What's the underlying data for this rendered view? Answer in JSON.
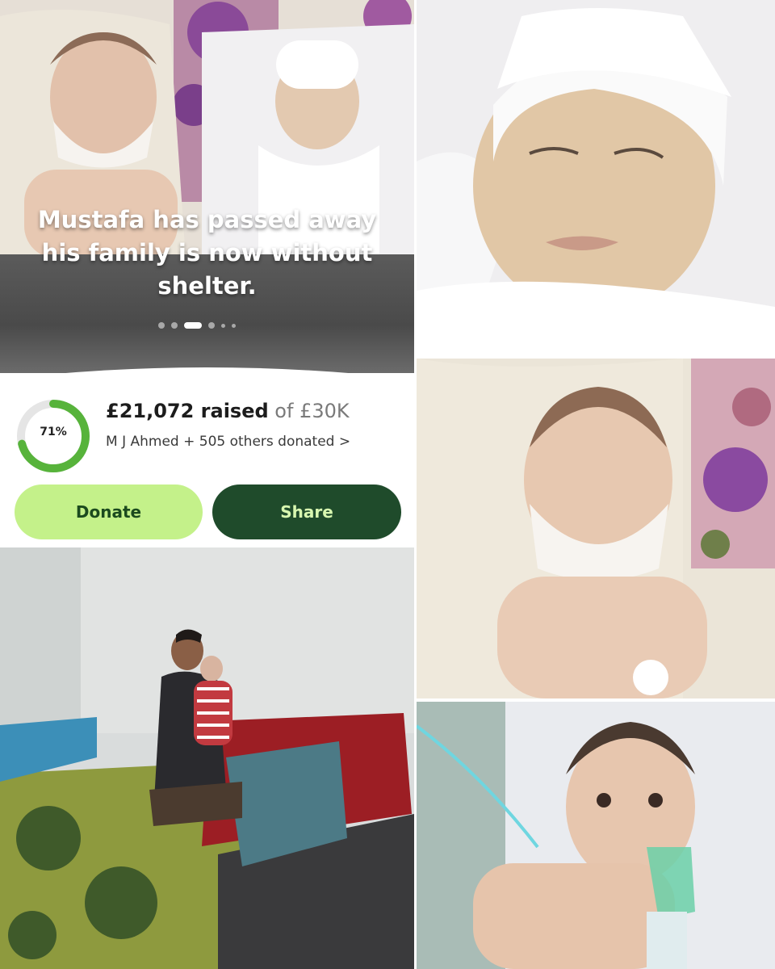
{
  "campaign": {
    "headline": "Mustafa has passed away his family is now without shelter.",
    "progress_percent": 71,
    "progress_label": "71%",
    "raised_amount": "£21,072 raised",
    "raised_target": " of £30K",
    "donors_text": "M J Ahmed + 505 others donated",
    "donors_chevron": ">",
    "slide_count": 6,
    "active_slide": 3
  },
  "actions": {
    "donate_label": "Donate",
    "share_label": "Share"
  },
  "colors": {
    "progress": "#57b33b",
    "track": "#e5e5e5",
    "donate_bg": "#c4f18a",
    "share_bg": "#1f4b2b"
  },
  "photos": {
    "hero": "two infants lying on white cloth",
    "right_top": "sleeping child with white bandage on head",
    "right_middle": "infant with chin bandage on knitted blanket",
    "right_bottom": "baby in hospital bed with oxygen mask",
    "bottom_left": "father holding baby in bare room"
  }
}
